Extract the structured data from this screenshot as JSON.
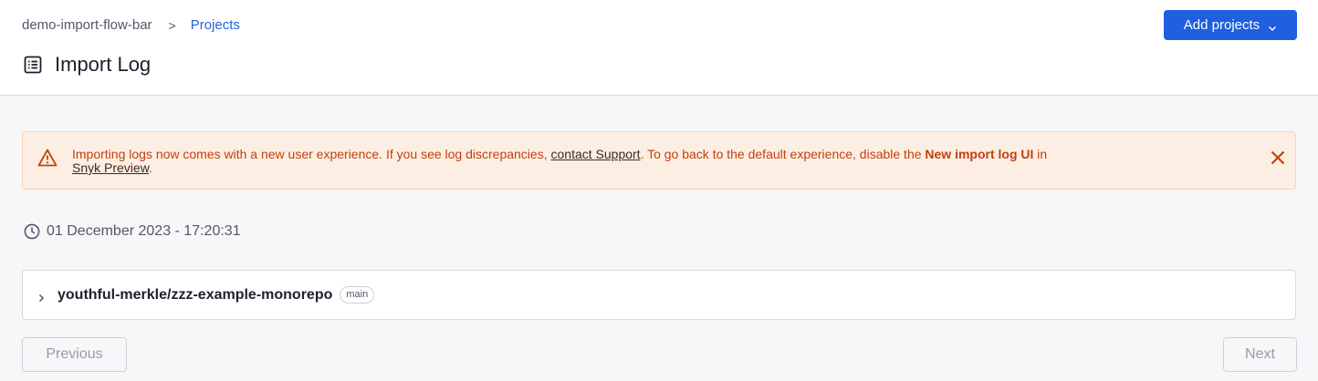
{
  "header": {
    "breadcrumb": {
      "org": "demo-import-flow-bar",
      "separator": ">",
      "current": "Projects"
    },
    "title": "Import Log",
    "add_projects_label": "Add projects"
  },
  "banner": {
    "text_1": "Importing logs now comes with a new user experience. If you see log discrepancies, ",
    "link_support": "contact Support",
    "text_2": ". To go back to the default experience, disable the ",
    "bold_setting": "New import log UI",
    "text_3": " in ",
    "link_preview": "Snyk Preview",
    "text_4": "."
  },
  "log": {
    "timestamp": "01 December 2023 - 17:20:31",
    "entries": [
      {
        "repo": "youthful-merkle/zzz-example-monorepo",
        "branch": "main"
      }
    ]
  },
  "pagination": {
    "previous_label": "Previous",
    "next_label": "Next"
  },
  "colors": {
    "accent": "#1f5fe0",
    "link": "#2563d9",
    "warning_text": "#c2410c",
    "warning_bg": "#fdeee3"
  },
  "icons": {
    "title": "list-icon",
    "dropdown": "chevron-down-icon",
    "banner": "warning-triangle-icon",
    "close": "close-icon",
    "timestamp": "clock-icon",
    "expand": "chevron-right-icon"
  }
}
